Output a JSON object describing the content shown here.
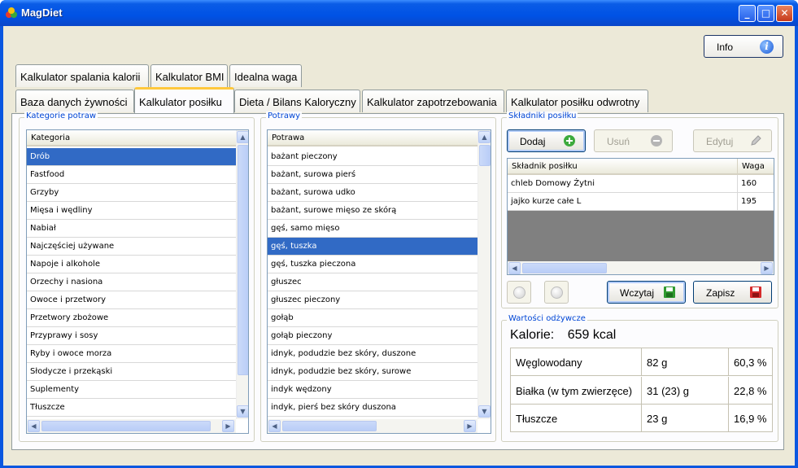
{
  "window": {
    "title": "MagDiet"
  },
  "info_button": {
    "label": "Info"
  },
  "tabs_row1": [
    "Kalkulator spalania kalorii",
    "Kalkulator BMI",
    "Idealna waga"
  ],
  "tabs_row2": [
    "Baza danych żywności",
    "Kalkulator posiłku",
    "Dieta / Bilans Kaloryczny",
    "Kalkulator zapotrzebowania",
    "Kalkulator posiłku odwrotny"
  ],
  "categories": {
    "group_title": "Kategorie potraw",
    "header": "Kategoria",
    "items": [
      "Drób",
      "Fastfood",
      "Grzyby",
      "Mięsa i wędliny",
      "Nabiał",
      "Najczęściej używane",
      "Napoje i alkohole",
      "Orzechy i nasiona",
      "Owoce i przetwory",
      "Przetwory zbożowe",
      "Przyprawy i sosy",
      "Ryby i owoce morza",
      "Słodycze i przekąski",
      "Suplementy",
      "Tłuszcze"
    ],
    "selected": 0
  },
  "dishes": {
    "group_title": "Potrawy",
    "header": "Potrawa",
    "items": [
      "bażant pieczony",
      "bażant, surowa pierś",
      "bażant, surowa udko",
      "bażant, surowe mięso ze skórą",
      "gęś, samo mięso",
      "gęś, tuszka",
      "gęś, tuszka pieczona",
      "głuszec",
      "głuszec pieczony",
      "gołąb",
      "gołąb pieczony",
      "idnyk, podudzie bez skóry, duszone",
      "idnyk, podudzie bez skóry, surowe",
      "indyk wędzony",
      "indyk, pierś bez skóry duszona"
    ],
    "selected": 5
  },
  "ingredients": {
    "group_title": "Składniki posiłku",
    "add_label": "Dodaj",
    "remove_label": "Usuń",
    "edit_label": "Edytuj",
    "col_name": "Składnik posiłku",
    "col_weight": "Waga",
    "rows": [
      {
        "name": "chleb Domowy Żytni",
        "weight": "160"
      },
      {
        "name": "jajko kurze całe L",
        "weight": "195"
      }
    ],
    "load_label": "Wczytaj",
    "save_label": "Zapisz"
  },
  "nutrition": {
    "group_title": "Wartości odżywcze",
    "calories_label": "Kalorie:",
    "calories_value": "659 kcal",
    "rows": [
      {
        "name": "Węglowodany",
        "grams": "82 g",
        "percent": "60,3 %"
      },
      {
        "name": "Białka (w tym zwierzęce)",
        "grams": "31 (23) g",
        "percent": "22,8 %"
      },
      {
        "name": "Tłuszcze",
        "grams": "23 g",
        "percent": "16,9 %"
      }
    ]
  },
  "colors": {
    "selection": "#316ac5",
    "group_title": "#0046d5",
    "tab_accent": "#ffc83c"
  }
}
